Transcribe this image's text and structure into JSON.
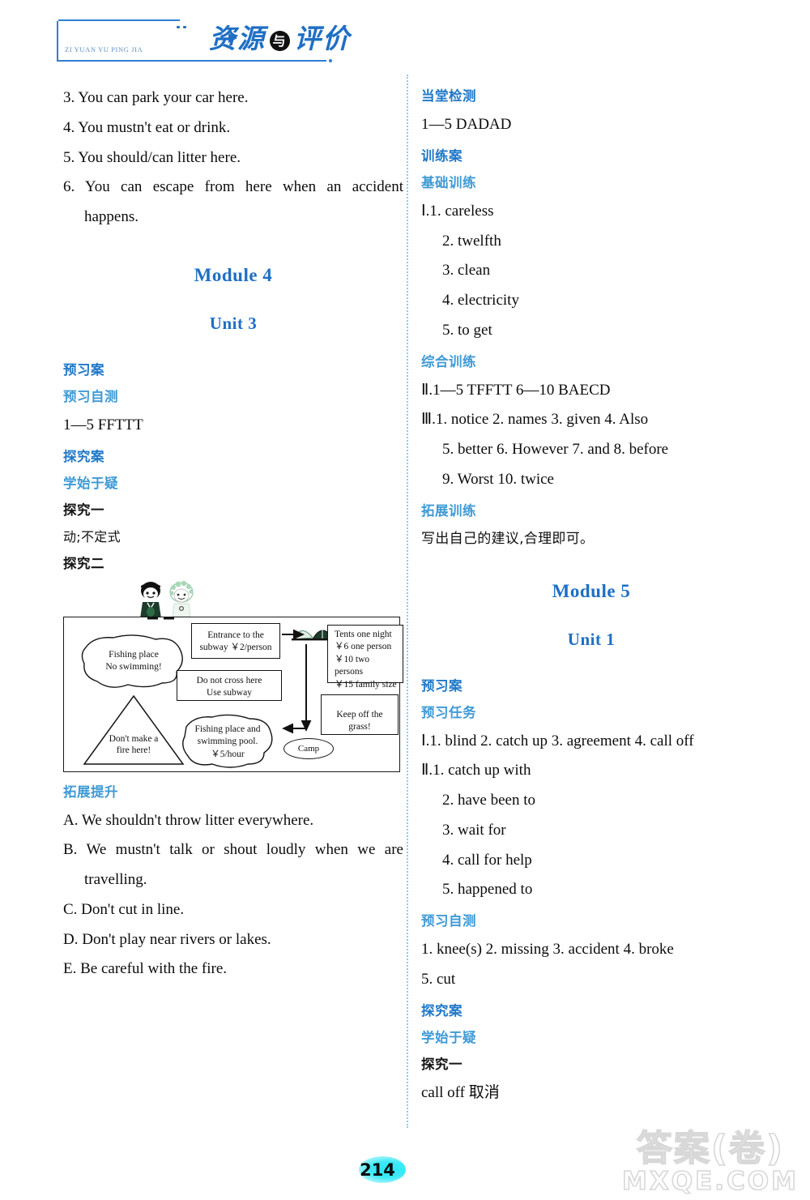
{
  "masthead": {
    "pinyin": "ZI YUAN YU PING JIA",
    "title_1": "资源",
    "title_mid": "与",
    "title_2": "评价"
  },
  "left_column": {
    "answers_top": [
      "3. You can park your car here.",
      "4. You mustn't eat or drink.",
      "5. You should/can litter here.",
      "6. You can escape from here when an accident",
      "happens."
    ],
    "module_title": "Module 4",
    "unit_title": "Unit 3",
    "h_yuxi_an": "预习案",
    "h_yuxi_zice": "预习自测",
    "yuxi_answer": "1—5    FFTTT",
    "h_tanjiu_an": "探究案",
    "h_xueshi_yuyi": "学始于疑",
    "h_tanjiu_1": "探究一",
    "tanjiu_1_answer": "动;不定式",
    "h_tanjiu_2": "探究二",
    "h_tuozhan_tisheng": "拓展提升",
    "tuozhan_items": [
      "A. We shouldn't throw litter everywhere.",
      "B. We mustn't talk or shout loudly when we are",
      "travelling.",
      "C. Don't cut in line.",
      "D. Don't play near rivers or lakes.",
      "E. Be careful with the fire."
    ]
  },
  "figure": {
    "name": "camp-rules-map",
    "signs": [
      {
        "id": "fishing-place",
        "lines": [
          "Fishing place",
          "No swimming!"
        ]
      },
      {
        "id": "dont-make-fire",
        "lines": [
          "Don't make a",
          "fire here!"
        ]
      },
      {
        "id": "entrance-subway",
        "lines": [
          "Entrance to the",
          "subway   ￥2/person"
        ]
      },
      {
        "id": "do-not-cross",
        "lines": [
          "Do not cross here",
          "Use subway"
        ]
      },
      {
        "id": "tents-price",
        "lines": [
          "Tents one night",
          "￥6 one person",
          "￥10 two persons",
          "￥15 family size"
        ]
      },
      {
        "id": "keep-off-grass",
        "lines": [
          "Keep off the grass!"
        ]
      },
      {
        "id": "fishing-swimming-pool",
        "lines": [
          "Fishing place and",
          "swimming pool.",
          "￥5/hour"
        ]
      },
      {
        "id": "camp-label",
        "lines": [
          "Camp"
        ]
      }
    ]
  },
  "right_column": {
    "h_dangtang_jiance": "当堂检测",
    "dangtang_answer": "1—5    DADAD",
    "h_xunlian_an": "训练案",
    "h_jichu_xunlian": "基础训练",
    "jichu_items": [
      "Ⅰ.1. careless",
      "2. twelfth",
      "3. clean",
      "4. electricity",
      "5. to get"
    ],
    "h_zonghe_xunlian": "综合训练",
    "zonghe_items": [
      "Ⅱ.1—5   TFFTT   6—10   BAECD",
      "Ⅲ.1. notice   2. names   3. given   4. Also",
      "5. better   6. However  7. and   8. before",
      "9. Worst   10. twice"
    ],
    "h_tuozhan_xunlian": "拓展训练",
    "tuozhan_xunlian_answer": "写出自己的建议,合理即可。",
    "module_title": "Module 5",
    "unit_title": "Unit 1",
    "h_yuxi_an": "预习案",
    "h_yuxi_renwu": "预习任务",
    "yuxi_renwu_items": [
      "Ⅰ.1. blind   2. catch up   3. agreement   4. call off",
      "Ⅱ.1. catch up with",
      "2. have been to",
      "3. wait for",
      "4. call for help",
      "5. happened to"
    ],
    "h_yuxi_zice": "预习自测",
    "yuxi_zice_items": [
      "1. knee(s)   2. missing   3. accident   4. broke",
      "5. cut"
    ],
    "h_tanjiu_an": "探究案",
    "h_xueshi_yuyi": "学始于疑",
    "h_tanjiu_1": "探究一",
    "tanjiu_1_answer": "call off 取消"
  },
  "footer": {
    "page_number": "214",
    "watermark_line1": "答案(卷)",
    "watermark_line2": "MXQE.COM"
  },
  "colors": {
    "heading_blue": "#1f78c8",
    "heading_light_blue": "#3f9ad6",
    "title_blue": "#1f6fc4",
    "divider_blue": "#8fcbe8",
    "page_badge": "#23e8f6"
  }
}
